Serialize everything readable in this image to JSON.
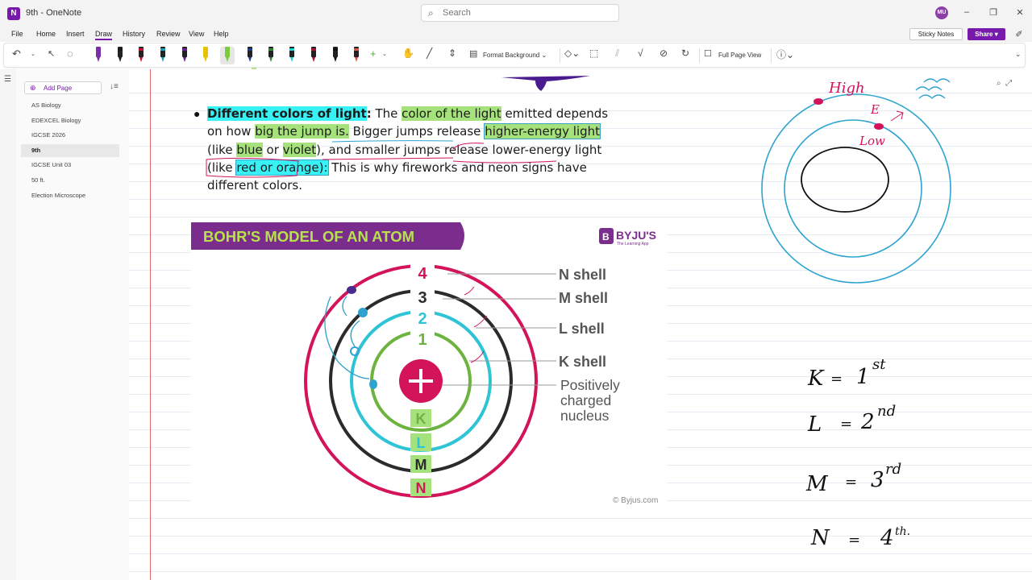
{
  "window": {
    "title": "9th - OneNote",
    "app_icon": "onenote-icon",
    "search_placeholder": "Search",
    "user_initials": "MU"
  },
  "menu": {
    "items": [
      "File",
      "Home",
      "Insert",
      "Draw",
      "History",
      "Review",
      "View",
      "Help"
    ],
    "active": "Draw",
    "sticky_notes": "Sticky Notes",
    "share": "Share"
  },
  "ribbon": {
    "format_background": "Format Background",
    "full_page_view": "Full Page View",
    "pen_colors": [
      "#7a2ea8",
      "#1a1a1a",
      "#c8102e",
      "#17a2b8",
      "#6a1b9a",
      "#e6c200",
      "#7ccb3a",
      "#1d3d8f",
      "#2e8b2e",
      "#1fd6d6",
      "#b0102a",
      "#111111",
      "#d9534f"
    ]
  },
  "sidebar": {
    "add_page": "Add Page",
    "pages": [
      "AS Biology",
      "EDEXCEL Biology",
      "IGCSE 2026",
      "9th",
      "IGCSE Unit 03",
      "50 ft.",
      "Election Microscope"
    ],
    "active_page": "9th"
  },
  "note": {
    "heading": "Different colors of light",
    "colon": ":",
    "t1": " The ",
    "h_color": "color of the light",
    "t2": " emitted depends on how ",
    "h_jump": "big the jump is.",
    "t3": " Bigger jumps release ",
    "h_energy": "higher-energy light",
    "t4": " (like ",
    "h_blue": "blue",
    "t5": " or ",
    "h_violet": "violet",
    "t6": "), and smaller jumps release lower-energy light (like ",
    "h_red": "red or orange):",
    "t7": " This is why fireworks and neon signs have different colors."
  },
  "diagram": {
    "banner": "BOHR'S MODEL OF AN ATOM",
    "brand": "BYJU'S",
    "brand_sub": "The Learning App",
    "shell_numbers": [
      "4",
      "3",
      "2",
      "1"
    ],
    "shell_labels": [
      "N shell",
      "M shell",
      "L shell",
      "K shell"
    ],
    "nucleus_label": [
      "Positively",
      "charged",
      "nucleus"
    ],
    "shell_letters": [
      "K",
      "L",
      "M",
      "N"
    ],
    "credit": "© Byjus.com",
    "colors": {
      "n": "#d4145a",
      "m": "#2b2b2b",
      "l": "#2ec4d6",
      "k": "#6db33f",
      "banner": "#7b2d8e",
      "banner_text": "#b6e34a"
    }
  },
  "ink": {
    "high": "High",
    "low": "Low",
    "e": "E",
    "list": [
      {
        "letter": "K",
        "ord": "1",
        "sup": "st"
      },
      {
        "letter": "L",
        "ord": "2",
        "sup": "nd"
      },
      {
        "letter": "M",
        "ord": "3",
        "sup": "rd"
      },
      {
        "letter": "N",
        "ord": "4",
        "sup": "th."
      }
    ]
  }
}
